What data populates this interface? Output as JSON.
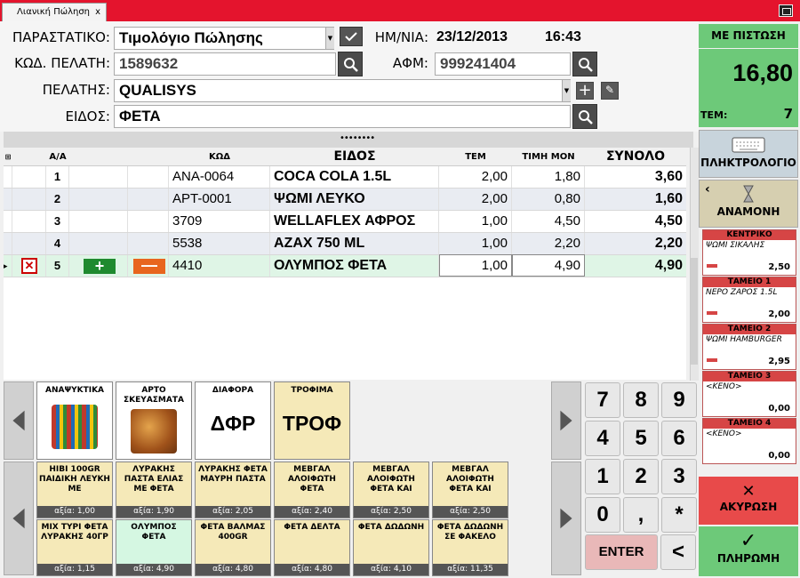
{
  "tab": {
    "title": "Λιανική Πώληση",
    "close": "x"
  },
  "form": {
    "document_label": "ΠΑΡΑΣΤΑΤΙΚΟ:",
    "document_value": "Τιμολόγιο Πώλησης",
    "date_label": "ΗΜ/ΝΙΑ:",
    "date_value": "23/12/2013",
    "time_value": "16:43",
    "customer_code_label": "ΚΩΔ. ΠΕΛΑΤΗ:",
    "customer_code_value": "1589632",
    "afm_label": "ΑΦΜ:",
    "afm_value": "999241404",
    "customer_label": "ΠΕΛΑΤΗΣ:",
    "customer_value": "QUALISYS",
    "item_label": "ΕΙΔΟΣ:",
    "item_value": "ΦΕΤΑ"
  },
  "grid": {
    "headers": {
      "aa": "Α/Α",
      "code": "ΚΩΔ",
      "name": "ΕΙΔΟΣ",
      "qty": "ΤΕΜ",
      "price": "ΤΙΜΗ ΜΟΝ",
      "total": "ΣΥΝΟΛΟ"
    },
    "rows": [
      {
        "aa": "1",
        "code": "ANA-0064",
        "name": "COCA COLA 1.5L",
        "qty": "2,00",
        "price": "1,80",
        "total": "3,60"
      },
      {
        "aa": "2",
        "code": "APT-0001",
        "name": "ΨΩΜΙ ΛΕΥΚΟ",
        "qty": "2,00",
        "price": "0,80",
        "total": "1,60"
      },
      {
        "aa": "3",
        "code": "3709",
        "name": "WELLAFLEX ΑΦΡΟΣ",
        "qty": "1,00",
        "price": "4,50",
        "total": "4,50"
      },
      {
        "aa": "4",
        "code": "5538",
        "name": "AZAX 750 ML",
        "qty": "1,00",
        "price": "2,20",
        "total": "2,20"
      },
      {
        "aa": "5",
        "code": "4410",
        "name": "ΟΛΥΜΠΟΣ ΦΕΤΑ",
        "qty": "1,00",
        "price": "4,90",
        "total": "4,90"
      }
    ]
  },
  "categories": [
    {
      "title": "ΑΝΑΨΥΚΤΙΚΑ",
      "big": ""
    },
    {
      "title": "ΑΡΤΟ ΣΚΕΥΑΣΜΑΤΑ",
      "big": ""
    },
    {
      "title": "ΔΙΑΦΟΡΑ",
      "big": "ΔΦΡ"
    },
    {
      "title": "ΤΡΟΦΙΜΑ",
      "big": "ΤΡΟΦ"
    }
  ],
  "products": [
    {
      "name": "ΗΙΒΙ 100GR ΠΑΙΔΙΚΗ ΛΕΥΚΗ ΜΕ",
      "price": "αξία: 1,00"
    },
    {
      "name": "ΛΥΡΑΚΗΣ ΠΑΣΤΑ ΕΛΙΑΣ ΜΕ ΦΕΤΑ",
      "price": "αξία: 1,90"
    },
    {
      "name": "ΛΥΡΑΚΗΣ ΦΕΤΑ ΜΑΥΡΗ ΠΑΣΤΑ",
      "price": "αξία: 2,05"
    },
    {
      "name": "ΜΕΒΓΑΛ ΑΛΟΙΦΩΤΗ ΦΕΤΑ",
      "price": "αξία: 2,40"
    },
    {
      "name": "ΜΕΒΓΑΛ ΑΛΟΙΦΩΤΗ ΦΕΤΑ ΚΑΙ",
      "price": "αξία: 2,50"
    },
    {
      "name": "ΜΕΒΓΑΛ ΑΛΟΙΦΩΤΗ ΦΕΤΑ ΚΑΙ",
      "price": "αξία: 2,50"
    },
    {
      "name": "ΜΙΧ ΤΥΡΙ ΦΕΤΑ ΛΥΡΑΚΗΣ 40ΓΡ",
      "price": "αξία: 1,15"
    },
    {
      "name": "ΟΛΥΜΠΟΣ ΦΕΤΑ",
      "price": "αξία: 4,90"
    },
    {
      "name": "ΦΕΤΑ ΒΑΛΜΑΣ 400GR",
      "price": "αξία: 4,80"
    },
    {
      "name": "ΦΕΤΑ ΔΕΛΤΑ",
      "price": "αξία: 4,80"
    },
    {
      "name": "ΦΕΤΑ ΔΩΔΩΝΗ",
      "price": "αξία: 4,10"
    },
    {
      "name": "ΦΕΤΑ ΔΩΔΩΝΗ ΣΕ ΦΑΚΕΛΟ",
      "price": "αξία: 11,35"
    }
  ],
  "keypad": [
    "7",
    "8",
    "9",
    "4",
    "5",
    "6",
    "1",
    "2",
    "3",
    "0",
    ",",
    "*"
  ],
  "keypad_enter": "ENTER",
  "keypad_back": "<",
  "summary": {
    "header": "ΜΕ ΠΙΣΤΩΣΗ",
    "total": "16,80",
    "items_label": "ΤΕΜ:",
    "items_value": "7"
  },
  "buttons": {
    "keyboard": "ΠΛΗΚΤΡΟΛΟΓΙΟ",
    "wait": "ΑΝΑΜΟΝΗ",
    "cancel": "ΑΚΥΡΩΣΗ",
    "pay": "ΠΛΗΡΩΜΗ"
  },
  "registers": [
    {
      "name": "ΚΕΝΤΡΙΚΟ",
      "item": "ΨΩΜΙ ΣΙΚΑΛΗΣ",
      "amount": "2,50"
    },
    {
      "name": "ΤΑΜΕΙΟ 1",
      "item": "ΝΕΡΟ ΖΑΡΟΣ 1.5L",
      "amount": "2,00"
    },
    {
      "name": "ΤΑΜΕΙΟ 2",
      "item": "ΨΩΜΙ HAMBURGER",
      "amount": "2,95"
    },
    {
      "name": "ΤΑΜΕΙΟ 3",
      "item": "<ΚΕΝΟ>",
      "amount": "0,00"
    },
    {
      "name": "ΤΑΜΕΙΟ 4",
      "item": "<ΚΕΝΟ>",
      "amount": "0,00"
    }
  ],
  "colors": {
    "title_red": "#e4142d",
    "credit_green": "#6dc979",
    "cancel_red": "#e84a4a",
    "tile_beige": "#f5e9b8",
    "selected_row": "#dff5e6"
  }
}
